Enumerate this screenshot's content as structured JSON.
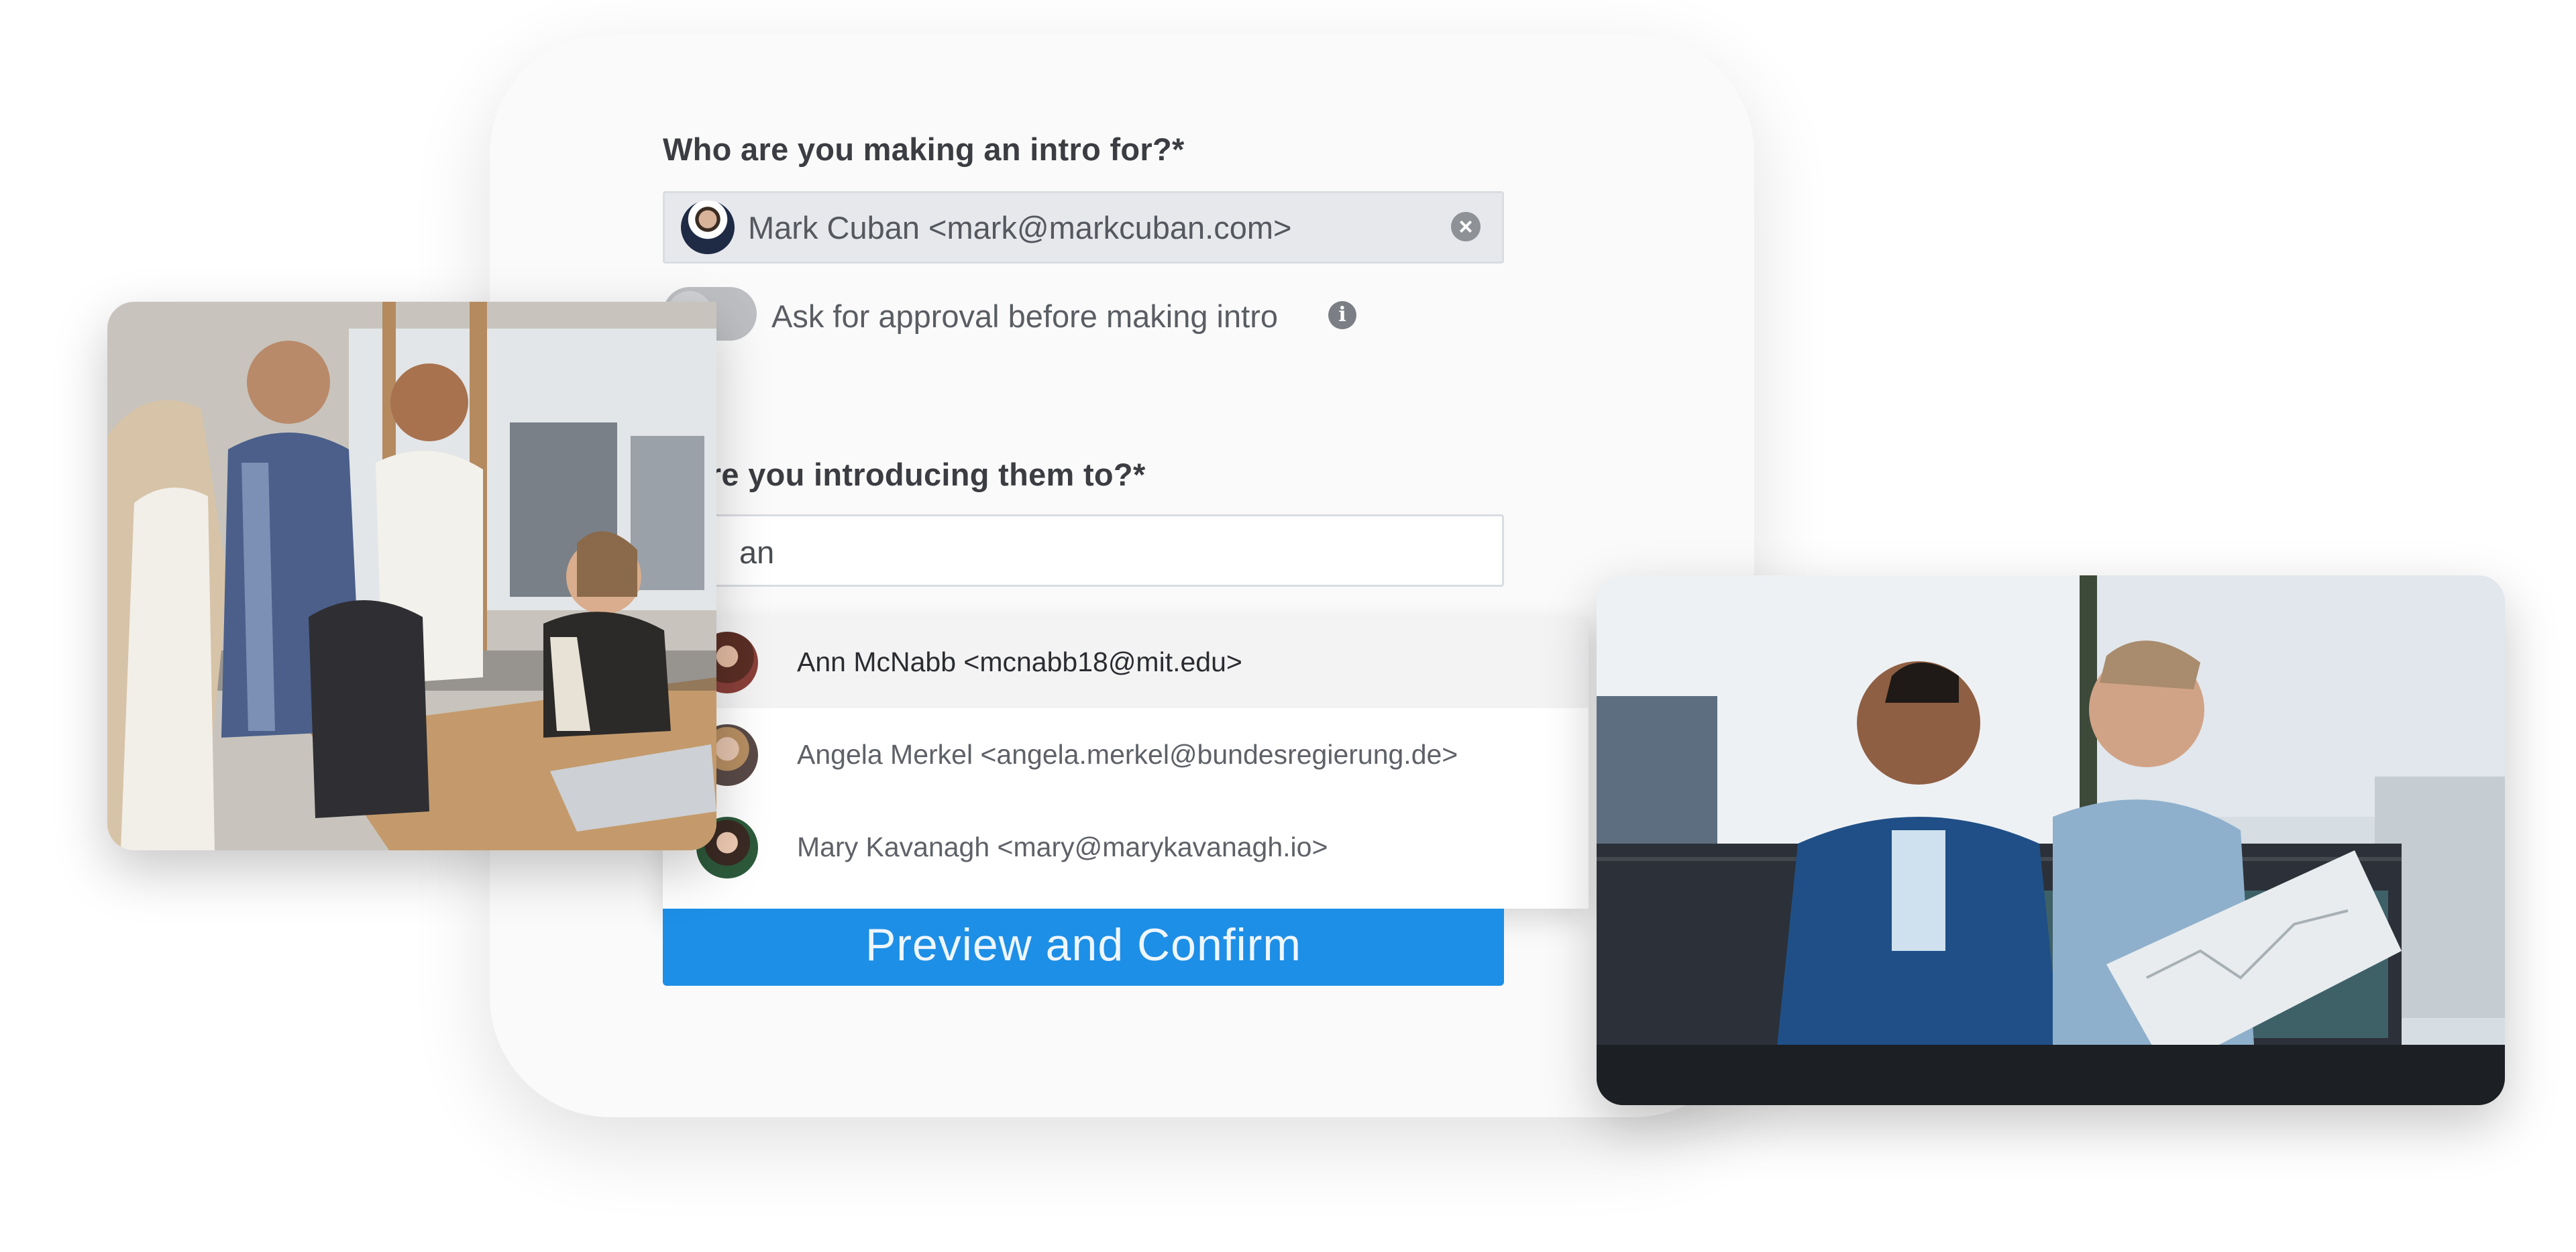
{
  "form": {
    "intro_for_label": "Who are you making an intro for?*",
    "selected_contact": "Mark Cuban <mark@markcuban.com>",
    "clear_symbol": "×",
    "approval_label": "Ask for approval before making intro",
    "info_symbol": "i",
    "introducing_to_label": "o are you introducing them to?*",
    "search_value": "an",
    "suggestions": [
      {
        "label": "Ann McNabb <mcnabb18@mit.edu>",
        "highlighted": true
      },
      {
        "label": "Angela Merkel <angela.merkel@bundesregierung.de>",
        "highlighted": false
      },
      {
        "label": "Mary Kavanagh <mary@marykavanagh.io>",
        "highlighted": false
      }
    ],
    "submit_label": "Preview and Confirm"
  },
  "colors": {
    "accent": "#1d8fe6",
    "card": "#fafafa",
    "selected_field": "#e6e8ec"
  },
  "icons": {
    "clear": "close-circle-icon",
    "info": "info-icon",
    "approval_toggle": "toggle-off"
  }
}
